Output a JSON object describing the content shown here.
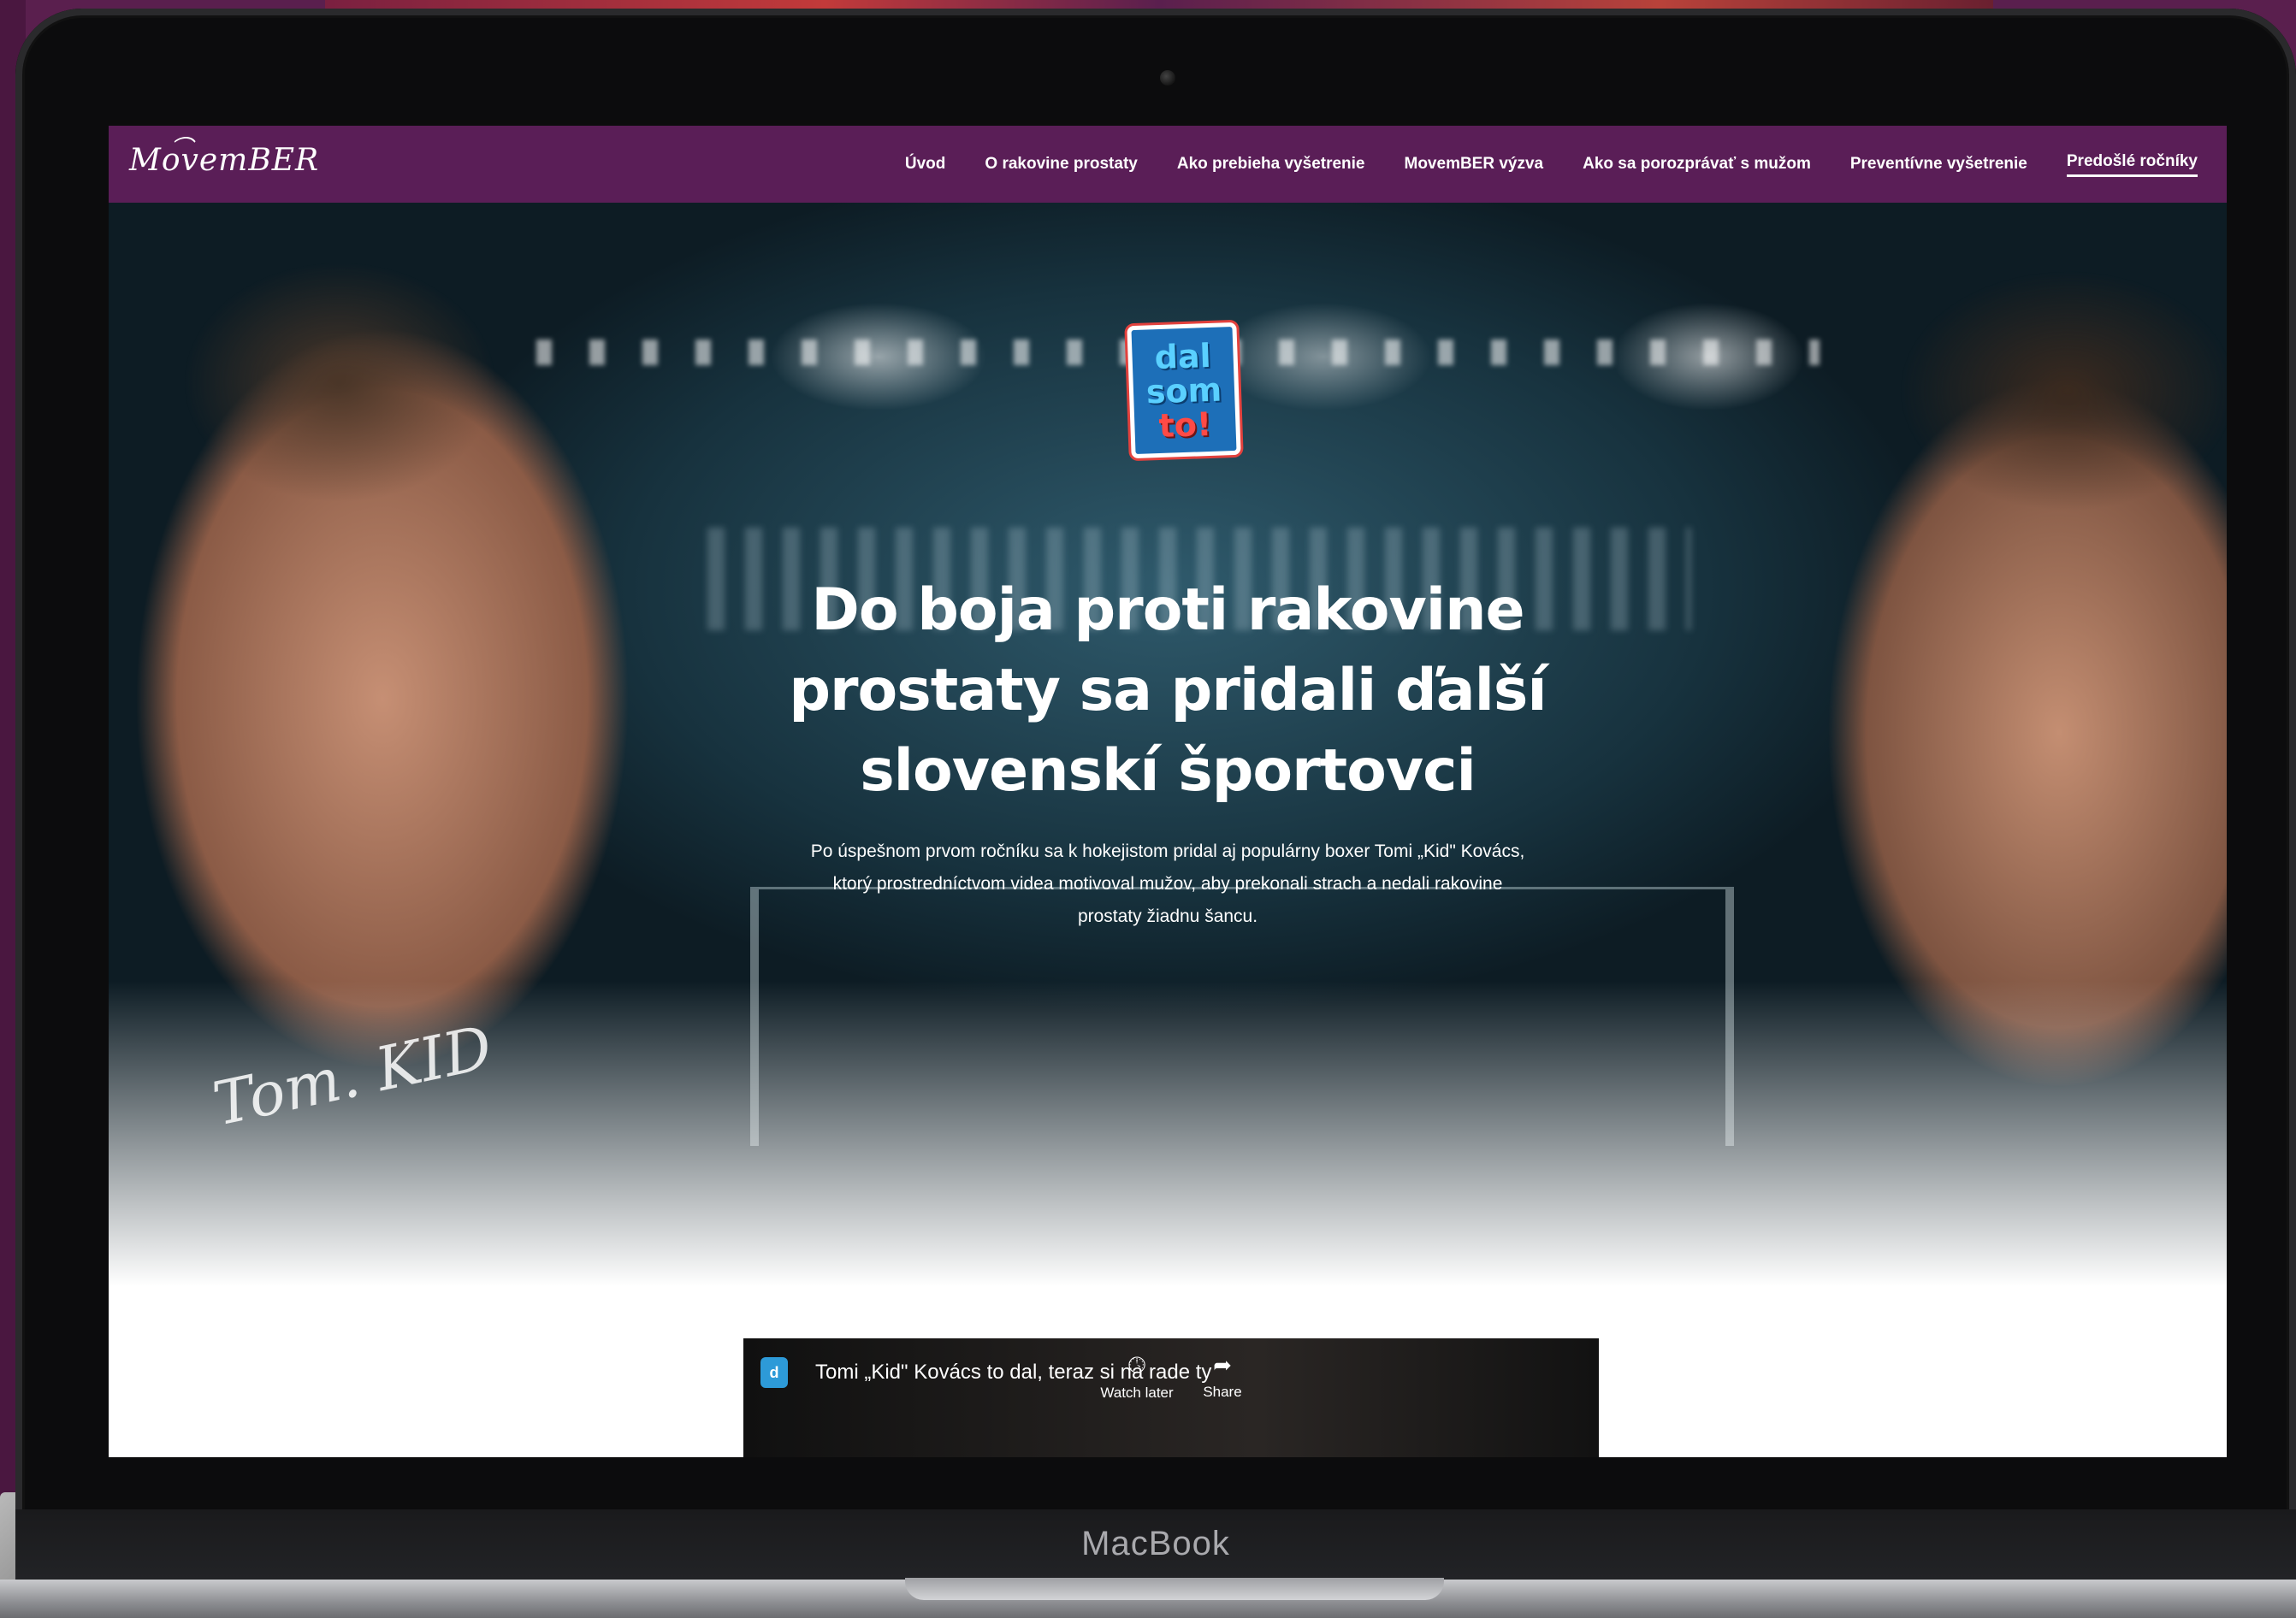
{
  "device": {
    "brand": "MacBook"
  },
  "site": {
    "logo": "MovemBER",
    "nav": [
      {
        "label": "Úvod"
      },
      {
        "label": "O rakovine prostaty"
      },
      {
        "label": "Ako prebieha vyšetrenie"
      },
      {
        "label": "MovemBER výzva"
      },
      {
        "label": "Ako sa porozprávať s mužom"
      },
      {
        "label": "Preventívne vyšetrenie"
      },
      {
        "label": "Predošlé ročníky",
        "active": true
      }
    ],
    "accent_color": "#5a1e57"
  },
  "hero": {
    "badge_lines": [
      "dal",
      "som",
      "to!"
    ],
    "headline": "Do boja proti rakovine prostaty sa pridali ďalší slovenskí športovci",
    "subtext": "Po úspešnom prvom ročníku sa k hokejistom pridal aj populárny boxer Tomi „Kid\" Kovács, ktorý prostredníctvom videa motivoval mužov, aby prekonali strach a nedali rakovine prostaty žiadnu šancu."
  },
  "video": {
    "title": "Tomi „Kid\" Kovács to dal, teraz si na rade ty",
    "watch_later": "Watch later",
    "share": "Share"
  }
}
